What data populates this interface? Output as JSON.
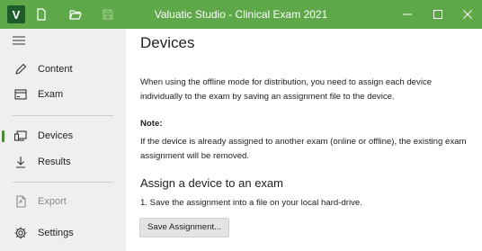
{
  "window": {
    "title": "Valuatic Studio - Clinical Exam 2021",
    "logo_letter": "V",
    "accent_color": "#5ea84a"
  },
  "toolbar_icons": [
    "new-file-icon",
    "open-folder-icon",
    "save-disk-icon"
  ],
  "window_controls": [
    "minimize-icon",
    "maximize-icon",
    "close-icon"
  ],
  "sidebar": {
    "items": [
      {
        "label": "Content",
        "icon": "pencil-icon",
        "active": false,
        "enabled": true
      },
      {
        "label": "Exam",
        "icon": "exam-icon",
        "active": false,
        "enabled": true
      },
      {
        "label": "Devices",
        "icon": "devices-icon",
        "active": true,
        "enabled": true
      },
      {
        "label": "Results",
        "icon": "download-icon",
        "active": false,
        "enabled": true
      },
      {
        "label": "Export",
        "icon": "export-icon",
        "active": false,
        "enabled": false
      },
      {
        "label": "Settings",
        "icon": "gear-icon",
        "active": false,
        "enabled": true
      }
    ]
  },
  "main": {
    "title": "Devices",
    "intro": "When using the offline mode for distribution, you need to assign each device individually to the exam by saving an assignment file to the device.",
    "note_heading": "Note:",
    "note_text": "If the device is already assigned to another exam (online or offline), the existing exam assignment will be removed.",
    "section_title": "Assign a device to an exam",
    "step1": "1. Save the assignment into a file on your local hard-drive.",
    "save_button": "Save Assignment..."
  }
}
